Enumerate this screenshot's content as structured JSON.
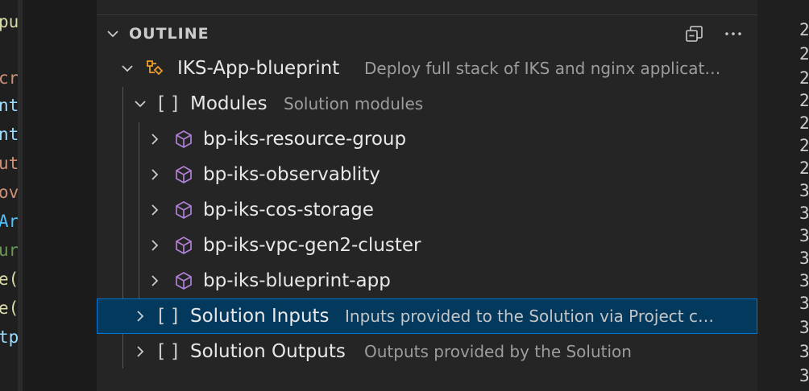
{
  "editor_left": {
    "lines": [
      {
        "text": "pu",
        "color": "#dcdcaa"
      },
      {
        "text": "",
        "color": "#cccccc"
      },
      {
        "text": "cr",
        "color": "#ce9178"
      },
      {
        "text": "nt",
        "color": "#9cdcfe"
      },
      {
        "text": "nt",
        "color": "#9cdcfe"
      },
      {
        "text": "ut",
        "color": "#ce9178"
      },
      {
        "text": "ov",
        "color": "#ce9178"
      },
      {
        "text": "Ar",
        "color": "#4fc1ff"
      },
      {
        "text": "ur",
        "color": "#6a9955"
      },
      {
        "text": "e(",
        "color": "#dcdcaa"
      },
      {
        "text": "e(",
        "color": "#dcdcaa"
      },
      {
        "text": "tp",
        "color": "#9cdcfe"
      }
    ]
  },
  "editor_right": {
    "line_numbers": [
      "2",
      "2",
      "2",
      "2",
      "2",
      "2",
      "2",
      "3",
      "3",
      "3",
      "3",
      "3",
      "3",
      "3",
      "3",
      "3"
    ]
  },
  "outline": {
    "title": "OUTLINE",
    "actions": [
      {
        "name": "collapse-all",
        "icon": "collapse-all-icon"
      },
      {
        "name": "more-actions",
        "icon": "ellipsis-icon"
      }
    ],
    "root": {
      "label": "IKS-App-blueprint",
      "description": "Deploy full stack of IKS and nginx applicat…",
      "icon": "namespace-icon",
      "expanded": true
    },
    "modules": {
      "bracket": "[ ]",
      "label": "Modules",
      "description": "Solution modules",
      "expanded": true,
      "items": [
        {
          "label": "bp-iks-resource-group"
        },
        {
          "label": "bp-iks-observablity"
        },
        {
          "label": "bp-iks-cos-storage"
        },
        {
          "label": "bp-iks-vpc-gen2-cluster"
        },
        {
          "label": "bp-iks-blueprint-app"
        }
      ]
    },
    "inputs": {
      "bracket": "[ ]",
      "label": "Solution Inputs",
      "description": "Inputs provided to the Solution via Project c…",
      "selected": true
    },
    "outputs": {
      "bracket": "[ ]",
      "label": "Solution Outputs",
      "description": "Outputs provided by the Solution"
    }
  },
  "colors": {
    "module_icon": "#b180d7",
    "namespace_icon": "#ee9d28",
    "selection_bg": "#04395e",
    "selection_border": "#0078d4"
  }
}
